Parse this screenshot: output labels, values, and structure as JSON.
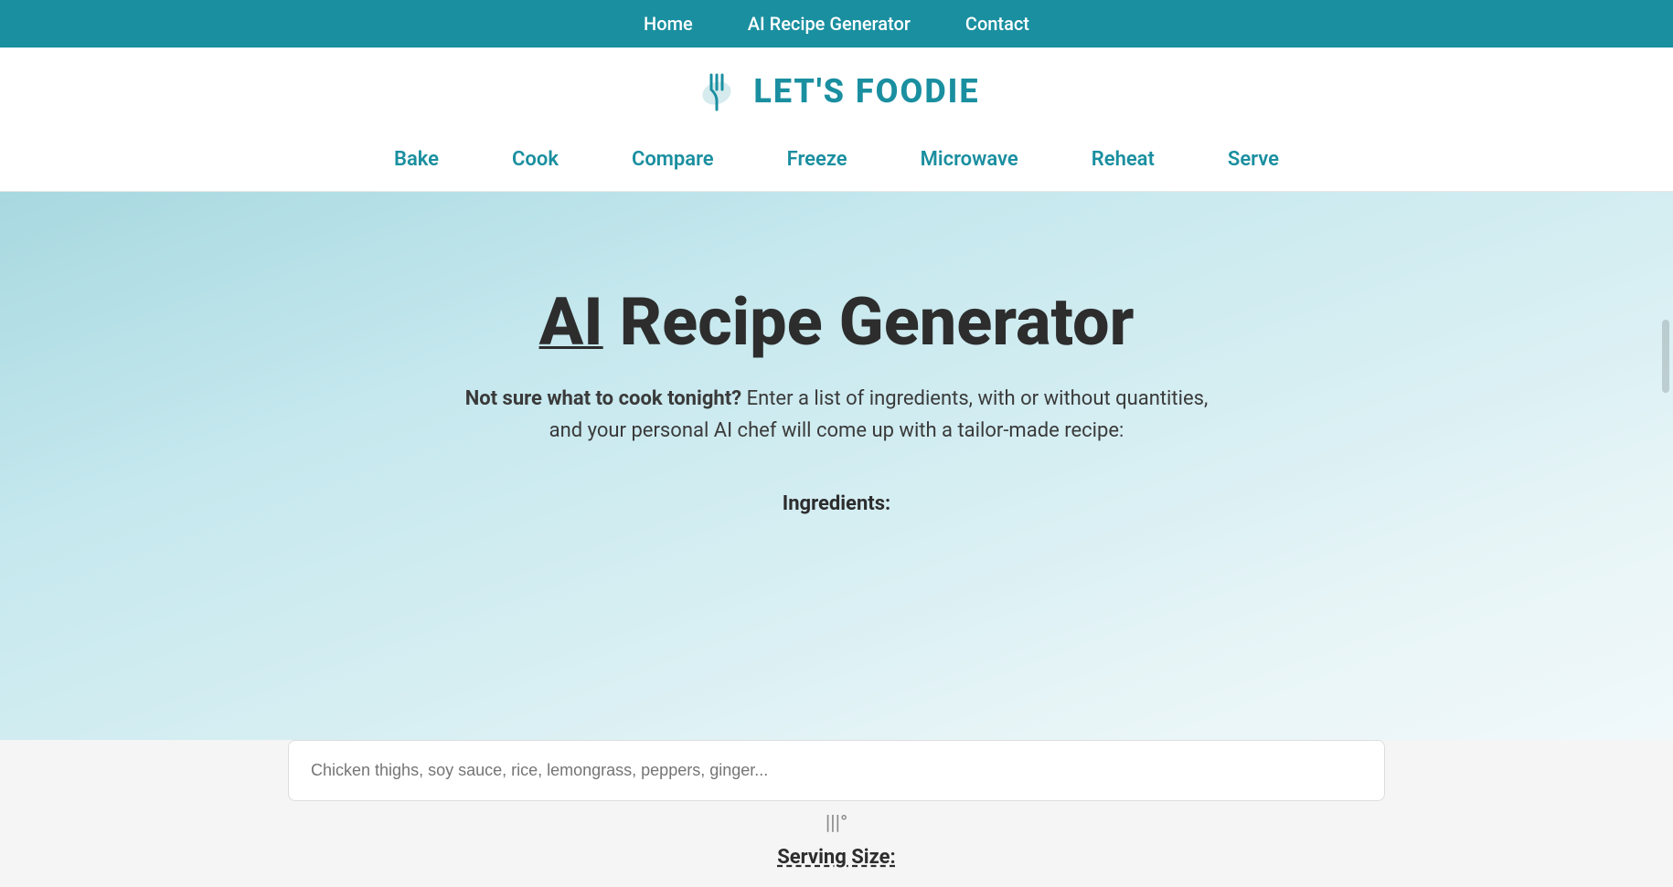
{
  "topNav": {
    "items": [
      {
        "label": "Home",
        "href": "#"
      },
      {
        "label": "AI Recipe Generator",
        "href": "#"
      },
      {
        "label": "Contact",
        "href": "#"
      }
    ]
  },
  "logo": {
    "text": "LET'S FOODIE"
  },
  "categoryNav": {
    "items": [
      {
        "label": "Bake",
        "href": "#"
      },
      {
        "label": "Cook",
        "href": "#"
      },
      {
        "label": "Compare",
        "href": "#"
      },
      {
        "label": "Freeze",
        "href": "#"
      },
      {
        "label": "Microwave",
        "href": "#"
      },
      {
        "label": "Reheat",
        "href": "#"
      },
      {
        "label": "Serve",
        "href": "#"
      }
    ]
  },
  "hero": {
    "title_ai": "AI",
    "title_rest": " Recipe Generator",
    "subtitle_bold": "Not sure what to cook tonight?",
    "subtitle_rest": " Enter a list of ingredients, with or without quantities, and your personal AI chef will come up with a tailor-made recipe:",
    "ingredients_label": "Ingredients:",
    "ingredients_placeholder": "Chicken thighs, soy sauce, rice, lemongrass, peppers, ginger...",
    "steam_icon": "|||°",
    "serving_label": "Serving Size:"
  },
  "colors": {
    "teal": "#1a8fa0",
    "dark_text": "#2d2d2d",
    "body_text": "#3a3a3a",
    "nav_bg": "#1a8fa0",
    "hero_bg_start": "#a8d8e0",
    "hero_bg_end": "#f0f8fa"
  }
}
